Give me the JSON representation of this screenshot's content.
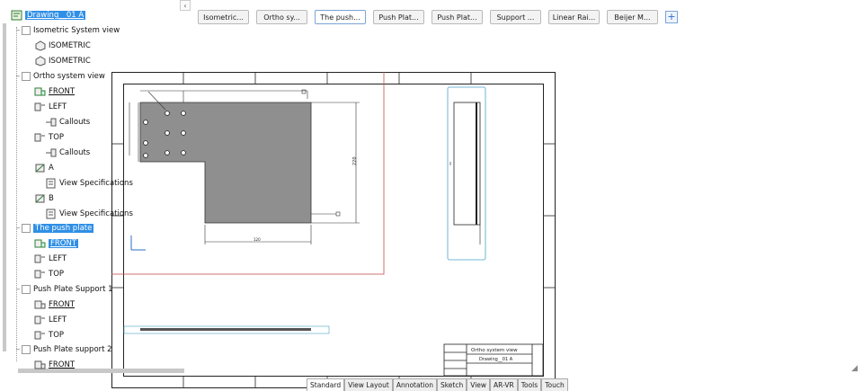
{
  "sheet_tabs": [
    "Isometric...",
    "Ortho sy...",
    "The push...",
    "Push Plat...",
    "Push Plat...",
    "Support ...",
    "Linear Rai...",
    "Beijer M..."
  ],
  "sheet_tab_active_index": 2,
  "add_tab_label": "+",
  "scroll_left_glyph": "‹",
  "tree": {
    "root": "Drawing__01 A",
    "items": [
      {
        "label": "Isometric System view"
      },
      {
        "label": "ISOMETRIC"
      },
      {
        "label": "ISOMETRIC"
      },
      {
        "label": "Ortho system view"
      },
      {
        "label": "FRONT"
      },
      {
        "label": "LEFT"
      },
      {
        "label": "Callouts"
      },
      {
        "label": "TOP"
      },
      {
        "label": "Callouts"
      },
      {
        "label": "A"
      },
      {
        "label": "View Specifications"
      },
      {
        "label": "B"
      },
      {
        "label": "View Specifications"
      },
      {
        "label": "The push plate"
      },
      {
        "label": "FRONT"
      },
      {
        "label": "LEFT"
      },
      {
        "label": "TOP"
      },
      {
        "label": "Push Plate Support 1"
      },
      {
        "label": "FRONT"
      },
      {
        "label": "LEFT"
      },
      {
        "label": "TOP"
      },
      {
        "label": "Push Plate support 2"
      },
      {
        "label": "FRONT"
      }
    ]
  },
  "drawing": {
    "dim_vertical": "220",
    "dim_horizontal": "120",
    "title_block_rows": [
      "Ortho system view",
      "Drawing__01 A",
      ""
    ],
    "title_block_left": [
      "",
      "",
      "",
      ""
    ]
  },
  "bottom_tabs": [
    "Standard",
    "View Layout",
    "Annotation",
    "Sketch",
    "View",
    "AR-VR",
    "Tools",
    "Touch"
  ],
  "bottom_tab_active_index": 0,
  "colors": {
    "selection": "#2f8fe6",
    "view_frame_red": "#c0504d",
    "view_frame_blue": "#4aa3c8",
    "part_fill": "#8f8f8f"
  },
  "resize_glyph": "◢"
}
